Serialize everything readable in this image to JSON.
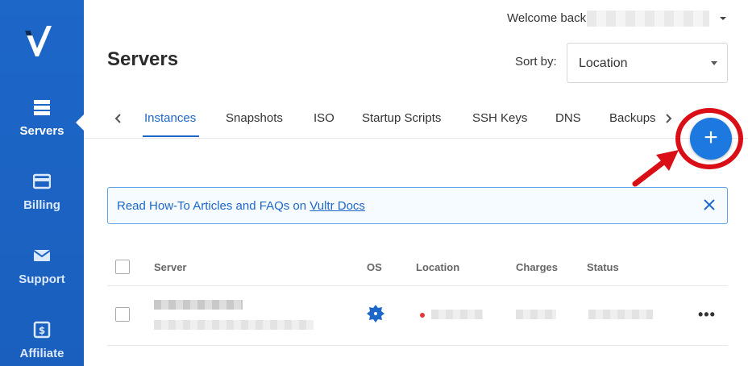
{
  "sidebar": {
    "items": [
      {
        "label": "Servers",
        "icon": "servers-icon",
        "active": true
      },
      {
        "label": "Billing",
        "icon": "credit-card-icon"
      },
      {
        "label": "Support",
        "icon": "envelope-icon"
      },
      {
        "label": "Affiliate",
        "icon": "dollar-icon"
      }
    ]
  },
  "header": {
    "welcome": "Welcome back",
    "title": "Servers",
    "sort_label": "Sort by:",
    "sort_value": "Location"
  },
  "tabs": [
    "Instances",
    "Snapshots",
    "ISO",
    "Startup Scripts",
    "SSH Keys",
    "DNS",
    "Backups"
  ],
  "active_tab": "Instances",
  "add_button_label": "+",
  "banner": {
    "text": "Read How-To Articles and FAQs on ",
    "link": "Vultr Docs"
  },
  "table": {
    "columns": [
      "Server",
      "OS",
      "Location",
      "Charges",
      "Status"
    ],
    "row_actions": "•••"
  },
  "colors": {
    "brand": "#1d67c9",
    "annotation": "#d90e16"
  }
}
